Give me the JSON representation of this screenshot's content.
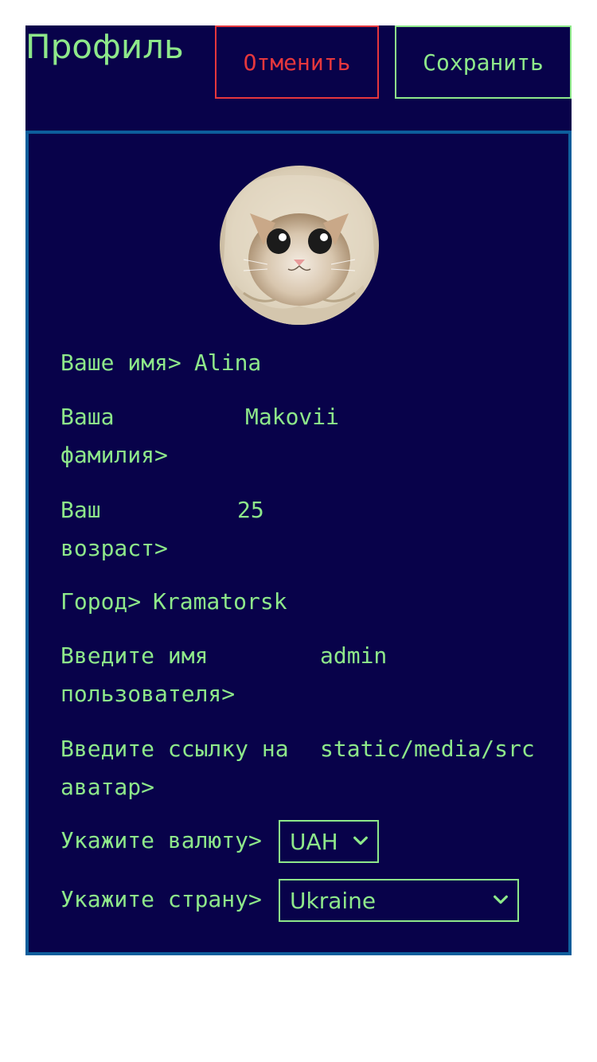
{
  "header": {
    "title": "Профиль",
    "cancel_label": "Отменить",
    "save_label": "Сохранить"
  },
  "profile": {
    "avatar_alt": "cat-in-hood-avatar",
    "fields": {
      "first_name": {
        "label": "Ваше имя>",
        "value": "Alina"
      },
      "last_name": {
        "label": "Ваша фамилия>",
        "value": "Makovii"
      },
      "age": {
        "label": "Ваш возраст>",
        "value": "25"
      },
      "city": {
        "label": "Город>",
        "value": "Kramatorsk"
      },
      "username": {
        "label": "Введите имя пользователя>",
        "value": "admin"
      },
      "avatar_url": {
        "label": "Введите ссылку на аватар>",
        "value": "static/media/src"
      },
      "currency": {
        "label": "Укажите валюту>",
        "value": "UAH"
      },
      "country": {
        "label": "Укажите страну>",
        "value": "Ukraine"
      }
    }
  },
  "colors": {
    "background": "#08024a",
    "text": "#8ee88a",
    "cancel": "#e5373d",
    "card_border": "#0d5e9c"
  }
}
